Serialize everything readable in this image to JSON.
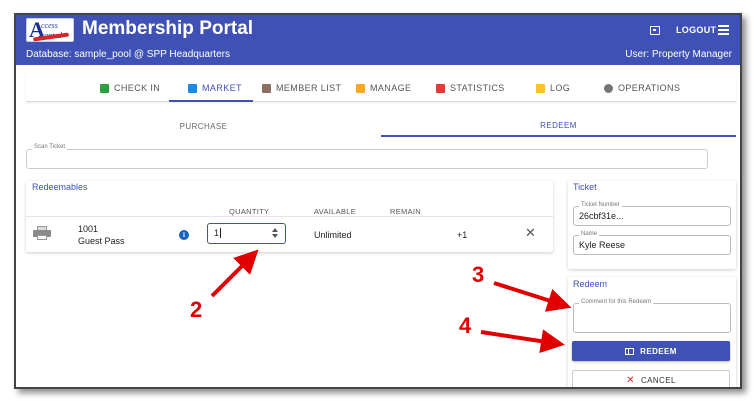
{
  "app": {
    "title": "Membership Portal",
    "logo_line1": "ccess",
    "logo_line2": "ranted",
    "logo_letter": "A",
    "database": "Database: sample_pool @ SPP Headquarters",
    "user": "User: Property Manager",
    "logout_label": "LOGOUT"
  },
  "nav": {
    "items": [
      {
        "label": "CHECK IN",
        "icon": "check-icon",
        "color": "#2e9e3e"
      },
      {
        "label": "MARKET",
        "icon": "cart-icon",
        "color": "#1e88e5"
      },
      {
        "label": "MEMBER LIST",
        "icon": "list-icon",
        "color": "#8d6e63"
      },
      {
        "label": "MANAGE",
        "icon": "pencil-icon",
        "color": "#f9a825"
      },
      {
        "label": "STATISTICS",
        "icon": "bar-chart-icon",
        "color": "#e53935"
      },
      {
        "label": "LOG",
        "icon": "log-icon",
        "color": "#fbc02d"
      },
      {
        "label": "OPERATIONS",
        "icon": "gear-icon",
        "color": "#757575"
      }
    ],
    "active": "MARKET"
  },
  "subtabs": {
    "purchase": "PURCHASE",
    "redeem": "REDEEM",
    "active": "REDEEM"
  },
  "scan": {
    "label": "Scan Ticket",
    "value": ""
  },
  "redeemables": {
    "title": "Redeemables",
    "columns": [
      "QUANTITY",
      "AVAILABLE",
      "REMAIN"
    ],
    "rows": [
      {
        "code": "1001",
        "name": "Guest Pass",
        "quantity": "1",
        "available": "Unlimited",
        "remain": "+1"
      }
    ]
  },
  "ticket": {
    "title": "Ticket",
    "number_label": "Ticket Number",
    "number_value": "26cbf31e...",
    "name_label": "Name",
    "name_value": "Kyle Reese"
  },
  "redeem_panel": {
    "title": "Redeem",
    "comment_label": "Comment for this Redeem",
    "comment_value": "",
    "redeem_button": "REDEEM",
    "cancel_button": "CANCEL"
  },
  "annotations": {
    "step2": "2",
    "step3": "3",
    "step4": "4",
    "color": "#e10000"
  }
}
